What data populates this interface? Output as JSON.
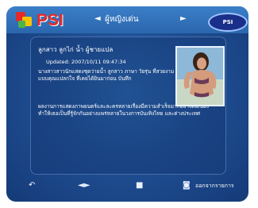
{
  "header": {
    "logo_text": "PSI",
    "nav_left": "◄",
    "nav_title": "ผู้หญิง​เด่น",
    "nav_right": "►",
    "brand": "PSI"
  },
  "article": {
    "title": "ลูกสาว ลูกไก่ น้ำ ผู้ชายแปล",
    "updated": "Updated: 2007/10/11 09:47:34",
    "paragraph1": "นางสาวสาวนักแสดงชุดว่ายน้ำ ลูกสาว ภาษา วัยรุ่น ที่สวยงาม แบบคุณแปลกใจ ที่เคยได้ยินมาก่อน บันทึก",
    "paragraph2": "ผลงานการแสดงภาพยนตร์และละครหลายเรื่องมีความสำเร็จมากอย่างต่อเนื่อง ทำให้เธอเป็นที่รู้จักกันอย่างแพร่หลายในวงการบันเทิงไทย และต่างประเทศ"
  },
  "footer": {
    "btn1": "↶",
    "btn2": "◄►",
    "btn3": "■",
    "btn4": "◙",
    "label": "ออกจากรายการ"
  },
  "colors": {
    "screen_bg": "#1f4f94",
    "header_bg": "#2b66ad",
    "logo_red": "#e32a2a",
    "text": "#ffffff"
  }
}
